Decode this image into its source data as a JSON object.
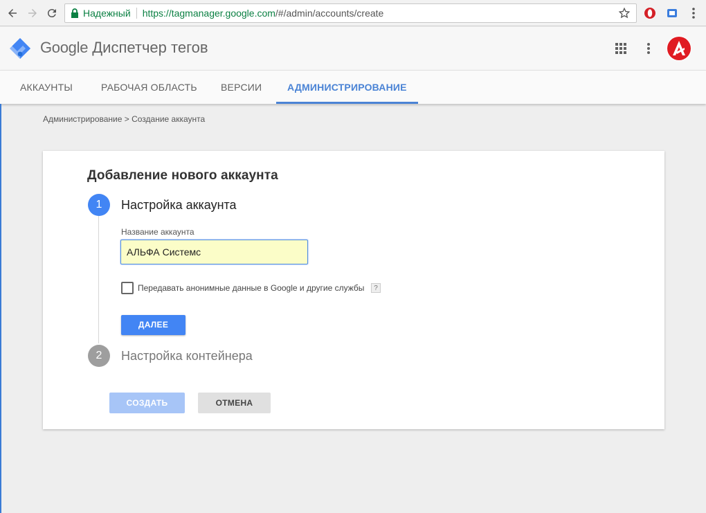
{
  "browser": {
    "secure_label": "Надежный",
    "url_host": "https://tagmanager.google.com",
    "url_path": "/#/admin/accounts/create"
  },
  "header": {
    "brand_google": "Google",
    "brand_product": "Диспетчер тегов"
  },
  "tabs": [
    {
      "label": "АККАУНТЫ"
    },
    {
      "label": "РАБОЧАЯ ОБЛАСТЬ"
    },
    {
      "label": "ВЕРСИИ"
    },
    {
      "label": "АДМИНИСТРИРОВАНИЕ",
      "active": true
    }
  ],
  "breadcrumb": "Администрирование > Создание аккаунта",
  "card": {
    "title": "Добавление нового аккаунта",
    "step1": {
      "number": "1",
      "title": "Настройка аккаунта"
    },
    "step2": {
      "number": "2",
      "title": "Настройка контейнера"
    },
    "account_name_label": "Название аккаунта",
    "account_name_value": "АЛЬФА Системс",
    "checkbox_label": "Передавать анонимные данные в Google и другие службы",
    "help_mark": "?",
    "next_button": "ДАЛЕЕ",
    "create_button": "СОЗДАТЬ",
    "cancel_button": "ОТМЕНА"
  },
  "colors": {
    "accent": "#4285f4",
    "active_tab": "#4a83d5",
    "secure_green": "#0b8043",
    "input_fill": "#fbfdc8"
  }
}
